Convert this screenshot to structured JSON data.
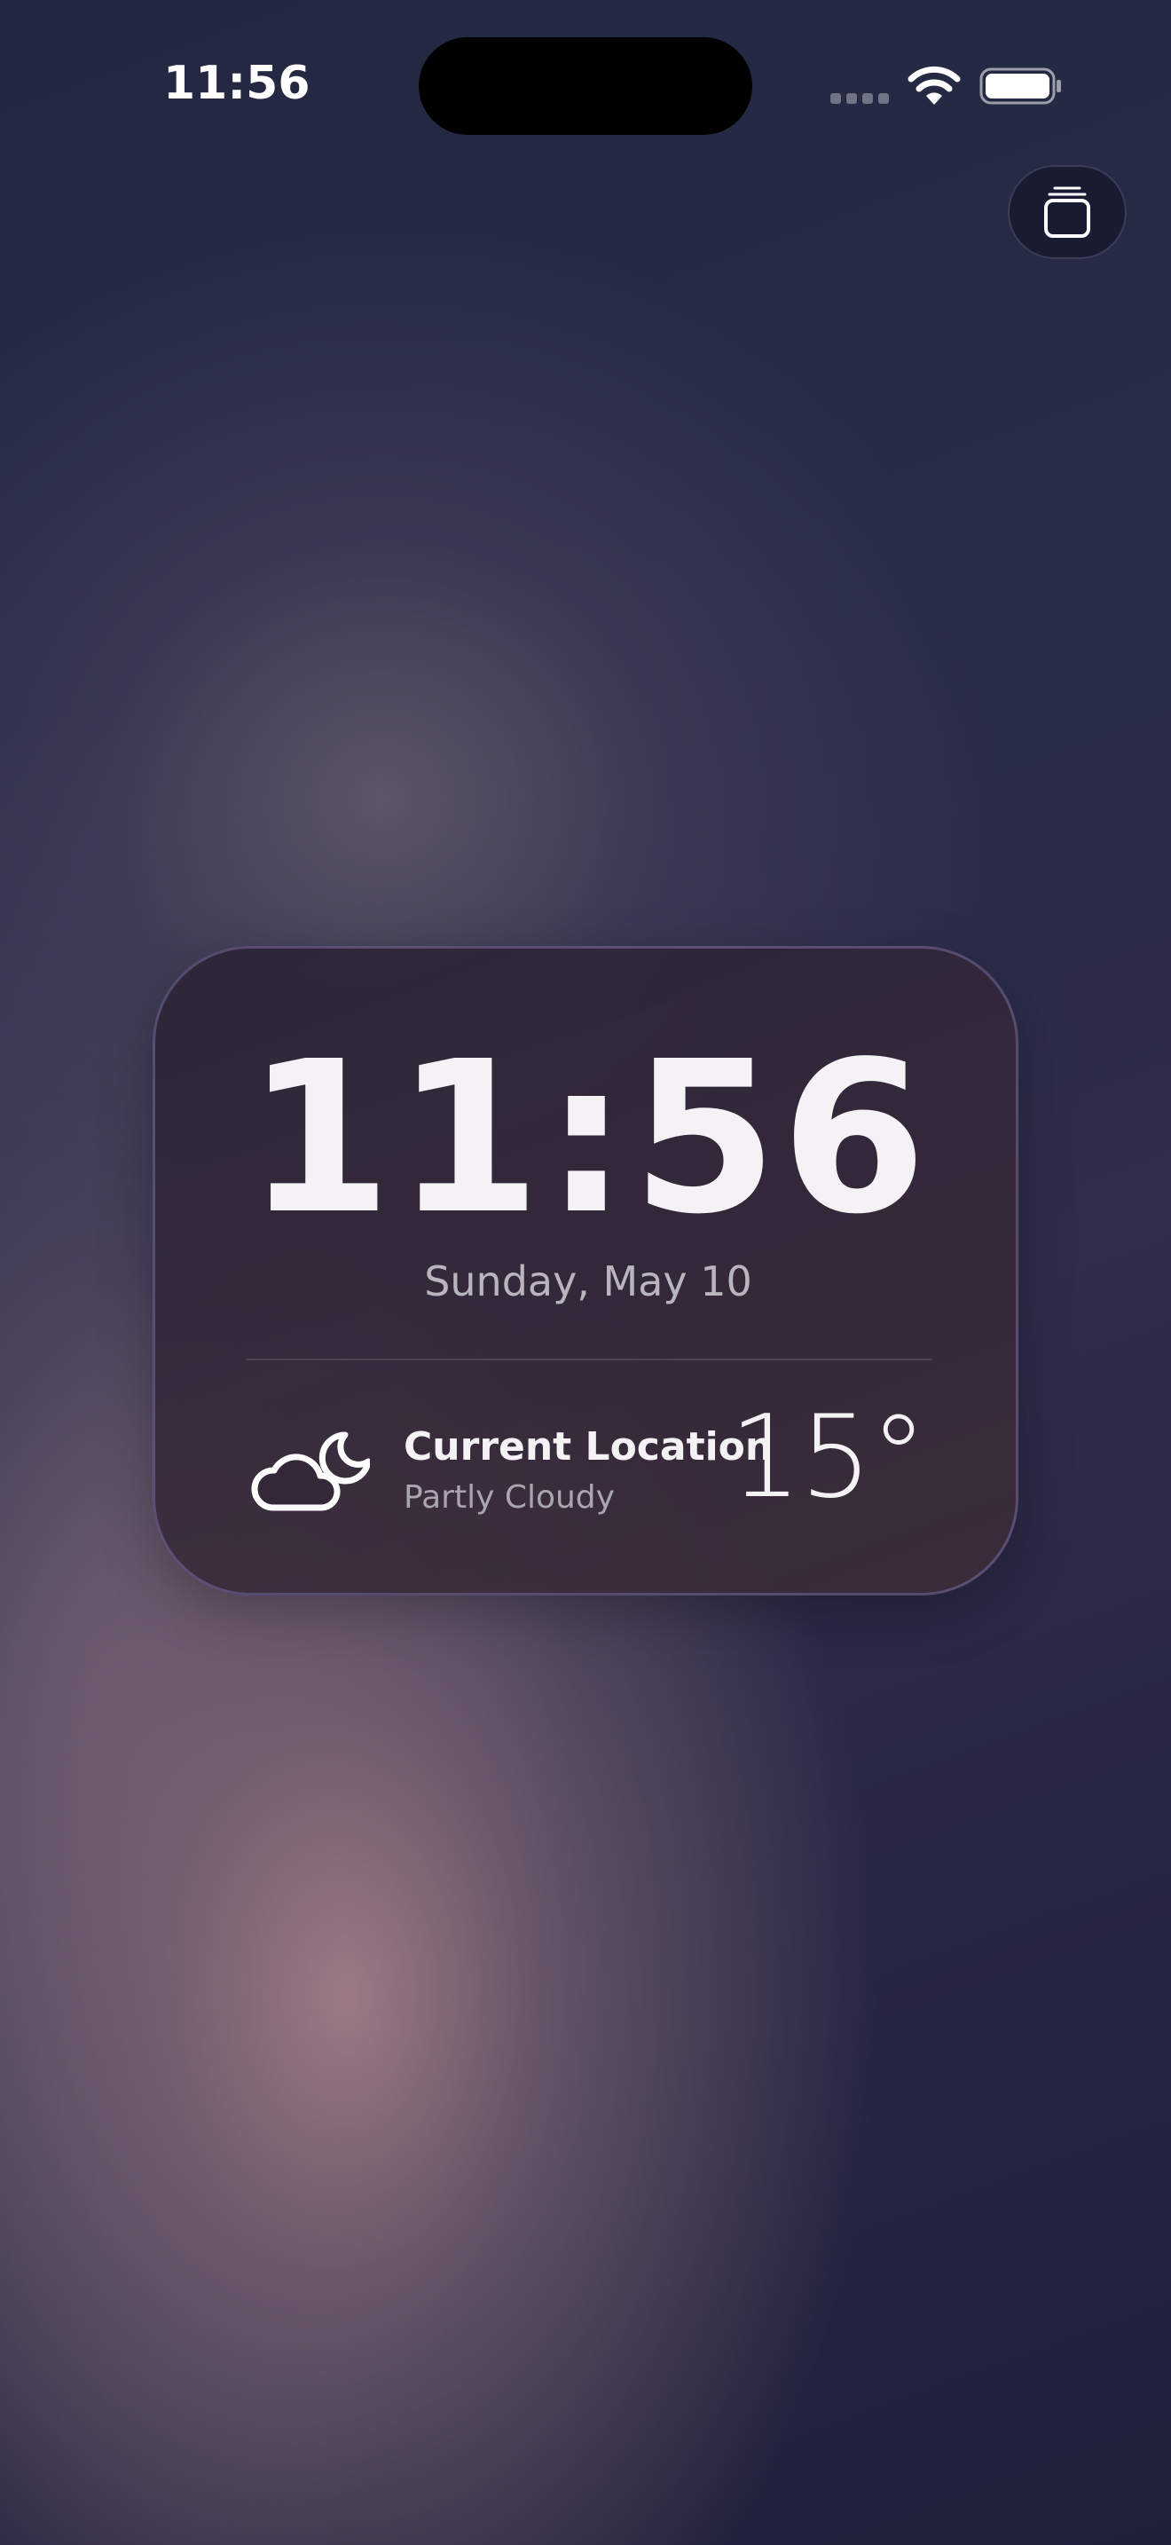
{
  "status_bar": {
    "time": "11:56",
    "signal_icon": "cellular-signal-icon",
    "wifi_icon": "wifi-icon",
    "battery_icon": "battery-icon"
  },
  "widget_button": {
    "icon": "stacked-cards-icon"
  },
  "card": {
    "clock": "11:56",
    "date": "Sunday, May 10",
    "weather": {
      "icon": "partly-cloudy-night-icon",
      "location": "Current Location",
      "condition": "Partly Cloudy",
      "temperature": "15°"
    }
  },
  "colors": {
    "text_primary": "#f4f2f5",
    "text_secondary": "#b9b4bd",
    "card_border": "#786aa0"
  }
}
